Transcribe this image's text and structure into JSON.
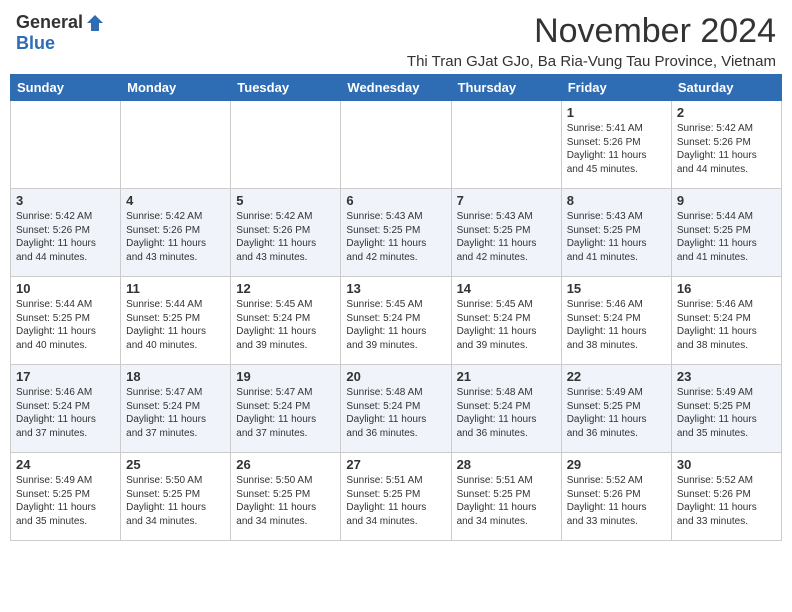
{
  "header": {
    "logo_general": "General",
    "logo_blue": "Blue",
    "month_title": "November 2024",
    "subtitle": "Thi Tran GJat GJo, Ba Ria-Vung Tau Province, Vietnam"
  },
  "days": [
    "Sunday",
    "Monday",
    "Tuesday",
    "Wednesday",
    "Thursday",
    "Friday",
    "Saturday"
  ],
  "weeks": [
    [
      {
        "date": "",
        "info": ""
      },
      {
        "date": "",
        "info": ""
      },
      {
        "date": "",
        "info": ""
      },
      {
        "date": "",
        "info": ""
      },
      {
        "date": "",
        "info": ""
      },
      {
        "date": "1",
        "info": "Sunrise: 5:41 AM\nSunset: 5:26 PM\nDaylight: 11 hours\nand 45 minutes."
      },
      {
        "date": "2",
        "info": "Sunrise: 5:42 AM\nSunset: 5:26 PM\nDaylight: 11 hours\nand 44 minutes."
      }
    ],
    [
      {
        "date": "3",
        "info": "Sunrise: 5:42 AM\nSunset: 5:26 PM\nDaylight: 11 hours\nand 44 minutes."
      },
      {
        "date": "4",
        "info": "Sunrise: 5:42 AM\nSunset: 5:26 PM\nDaylight: 11 hours\nand 43 minutes."
      },
      {
        "date": "5",
        "info": "Sunrise: 5:42 AM\nSunset: 5:26 PM\nDaylight: 11 hours\nand 43 minutes."
      },
      {
        "date": "6",
        "info": "Sunrise: 5:43 AM\nSunset: 5:25 PM\nDaylight: 11 hours\nand 42 minutes."
      },
      {
        "date": "7",
        "info": "Sunrise: 5:43 AM\nSunset: 5:25 PM\nDaylight: 11 hours\nand 42 minutes."
      },
      {
        "date": "8",
        "info": "Sunrise: 5:43 AM\nSunset: 5:25 PM\nDaylight: 11 hours\nand 41 minutes."
      },
      {
        "date": "9",
        "info": "Sunrise: 5:44 AM\nSunset: 5:25 PM\nDaylight: 11 hours\nand 41 minutes."
      }
    ],
    [
      {
        "date": "10",
        "info": "Sunrise: 5:44 AM\nSunset: 5:25 PM\nDaylight: 11 hours\nand 40 minutes."
      },
      {
        "date": "11",
        "info": "Sunrise: 5:44 AM\nSunset: 5:25 PM\nDaylight: 11 hours\nand 40 minutes."
      },
      {
        "date": "12",
        "info": "Sunrise: 5:45 AM\nSunset: 5:24 PM\nDaylight: 11 hours\nand 39 minutes."
      },
      {
        "date": "13",
        "info": "Sunrise: 5:45 AM\nSunset: 5:24 PM\nDaylight: 11 hours\nand 39 minutes."
      },
      {
        "date": "14",
        "info": "Sunrise: 5:45 AM\nSunset: 5:24 PM\nDaylight: 11 hours\nand 39 minutes."
      },
      {
        "date": "15",
        "info": "Sunrise: 5:46 AM\nSunset: 5:24 PM\nDaylight: 11 hours\nand 38 minutes."
      },
      {
        "date": "16",
        "info": "Sunrise: 5:46 AM\nSunset: 5:24 PM\nDaylight: 11 hours\nand 38 minutes."
      }
    ],
    [
      {
        "date": "17",
        "info": "Sunrise: 5:46 AM\nSunset: 5:24 PM\nDaylight: 11 hours\nand 37 minutes."
      },
      {
        "date": "18",
        "info": "Sunrise: 5:47 AM\nSunset: 5:24 PM\nDaylight: 11 hours\nand 37 minutes."
      },
      {
        "date": "19",
        "info": "Sunrise: 5:47 AM\nSunset: 5:24 PM\nDaylight: 11 hours\nand 37 minutes."
      },
      {
        "date": "20",
        "info": "Sunrise: 5:48 AM\nSunset: 5:24 PM\nDaylight: 11 hours\nand 36 minutes."
      },
      {
        "date": "21",
        "info": "Sunrise: 5:48 AM\nSunset: 5:24 PM\nDaylight: 11 hours\nand 36 minutes."
      },
      {
        "date": "22",
        "info": "Sunrise: 5:49 AM\nSunset: 5:25 PM\nDaylight: 11 hours\nand 36 minutes."
      },
      {
        "date": "23",
        "info": "Sunrise: 5:49 AM\nSunset: 5:25 PM\nDaylight: 11 hours\nand 35 minutes."
      }
    ],
    [
      {
        "date": "24",
        "info": "Sunrise: 5:49 AM\nSunset: 5:25 PM\nDaylight: 11 hours\nand 35 minutes."
      },
      {
        "date": "25",
        "info": "Sunrise: 5:50 AM\nSunset: 5:25 PM\nDaylight: 11 hours\nand 34 minutes."
      },
      {
        "date": "26",
        "info": "Sunrise: 5:50 AM\nSunset: 5:25 PM\nDaylight: 11 hours\nand 34 minutes."
      },
      {
        "date": "27",
        "info": "Sunrise: 5:51 AM\nSunset: 5:25 PM\nDaylight: 11 hours\nand 34 minutes."
      },
      {
        "date": "28",
        "info": "Sunrise: 5:51 AM\nSunset: 5:25 PM\nDaylight: 11 hours\nand 34 minutes."
      },
      {
        "date": "29",
        "info": "Sunrise: 5:52 AM\nSunset: 5:26 PM\nDaylight: 11 hours\nand 33 minutes."
      },
      {
        "date": "30",
        "info": "Sunrise: 5:52 AM\nSunset: 5:26 PM\nDaylight: 11 hours\nand 33 minutes."
      }
    ]
  ]
}
